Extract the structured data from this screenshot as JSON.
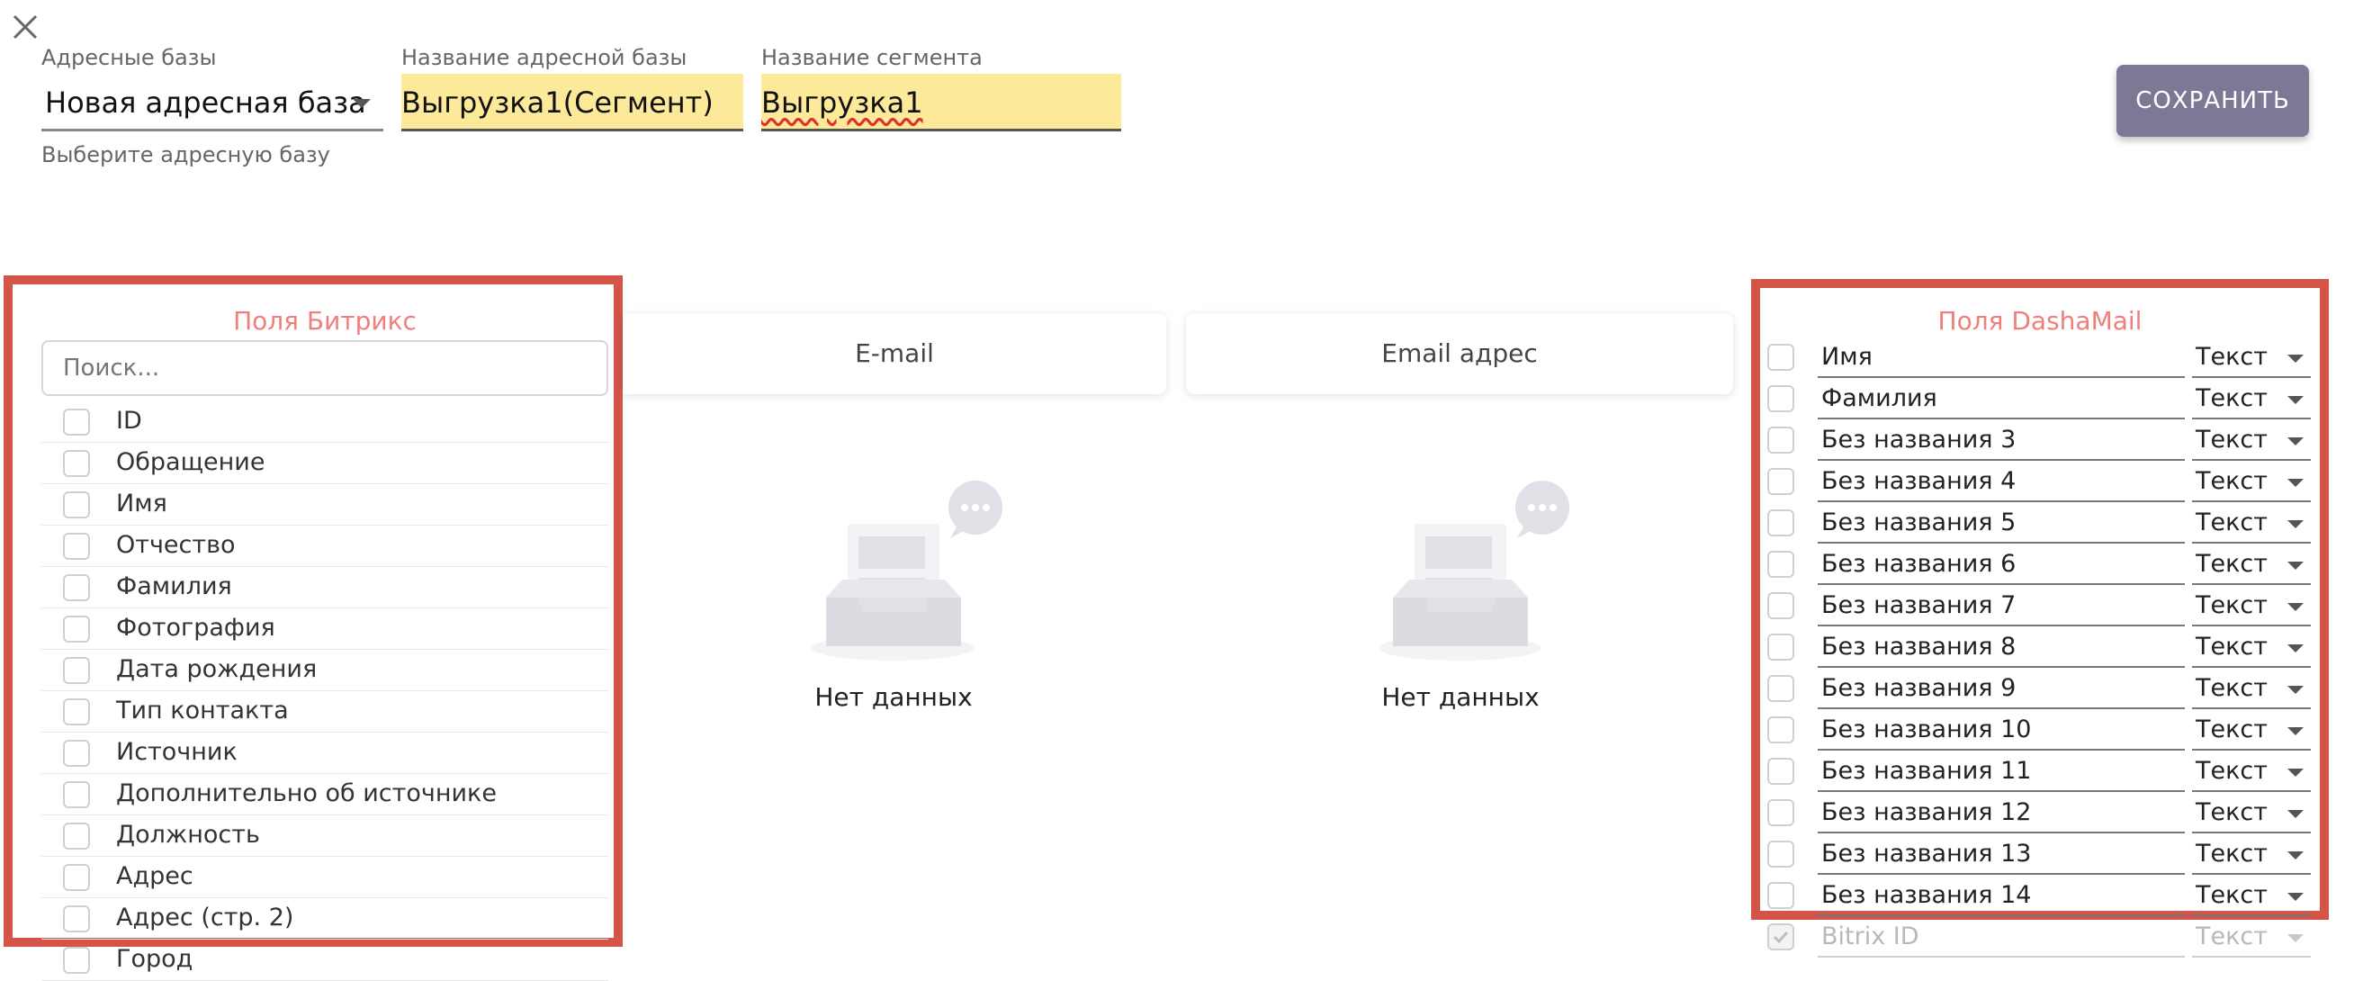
{
  "header": {
    "address_base": {
      "label": "Адресные базы",
      "value": "Новая адресная база",
      "hint": "Выберите адресную базу"
    },
    "base_name": {
      "label": "Название адресной базы",
      "value": "Выгрузка1(Сегмент)"
    },
    "segment_name": {
      "label": "Название сегмента",
      "value": "Выгрузка1"
    },
    "save_label": "СОХРАНИТЬ"
  },
  "left_panel": {
    "title": "Поля Битрикс",
    "search_placeholder": "Поиск...",
    "items": [
      "ID",
      "Обращение",
      "Имя",
      "Отчество",
      "Фамилия",
      "Фотография",
      "Дата рождения",
      "Тип контакта",
      "Источник",
      "Дополнительно об источнике",
      "Должность",
      "Адрес",
      "Адрес (стр. 2)",
      "Город"
    ]
  },
  "middle": {
    "columns": [
      {
        "header": "E-mail",
        "empty_text": "Нет данных"
      },
      {
        "header": "Email адрес",
        "empty_text": "Нет данных"
      }
    ]
  },
  "right_panel": {
    "title": "Поля DashaMail",
    "fields": [
      {
        "name": "Имя",
        "type": "Текст",
        "checked": false,
        "disabled": false
      },
      {
        "name": "Фамилия",
        "type": "Текст",
        "checked": false,
        "disabled": false
      },
      {
        "name": "Без названия 3",
        "type": "Текст",
        "checked": false,
        "disabled": false
      },
      {
        "name": "Без названия 4",
        "type": "Текст",
        "checked": false,
        "disabled": false
      },
      {
        "name": "Без названия 5",
        "type": "Текст",
        "checked": false,
        "disabled": false
      },
      {
        "name": "Без названия 6",
        "type": "Текст",
        "checked": false,
        "disabled": false
      },
      {
        "name": "Без названия 7",
        "type": "Текст",
        "checked": false,
        "disabled": false
      },
      {
        "name": "Без названия 8",
        "type": "Текст",
        "checked": false,
        "disabled": false
      },
      {
        "name": "Без названия 9",
        "type": "Текст",
        "checked": false,
        "disabled": false
      },
      {
        "name": "Без названия 10",
        "type": "Текст",
        "checked": false,
        "disabled": false
      },
      {
        "name": "Без названия 11",
        "type": "Текст",
        "checked": false,
        "disabled": false
      },
      {
        "name": "Без названия 12",
        "type": "Текст",
        "checked": false,
        "disabled": false
      },
      {
        "name": "Без названия 13",
        "type": "Текст",
        "checked": false,
        "disabled": false
      },
      {
        "name": "Без названия 14",
        "type": "Текст",
        "checked": false,
        "disabled": false
      },
      {
        "name": "Bitrix ID",
        "type": "Текст",
        "checked": true,
        "disabled": true
      }
    ]
  },
  "colors": {
    "accent_frame": "#d5544a",
    "panel_title": "#f07f7a",
    "field_highlight": "#fde99a",
    "save_button": "#7d7896"
  }
}
